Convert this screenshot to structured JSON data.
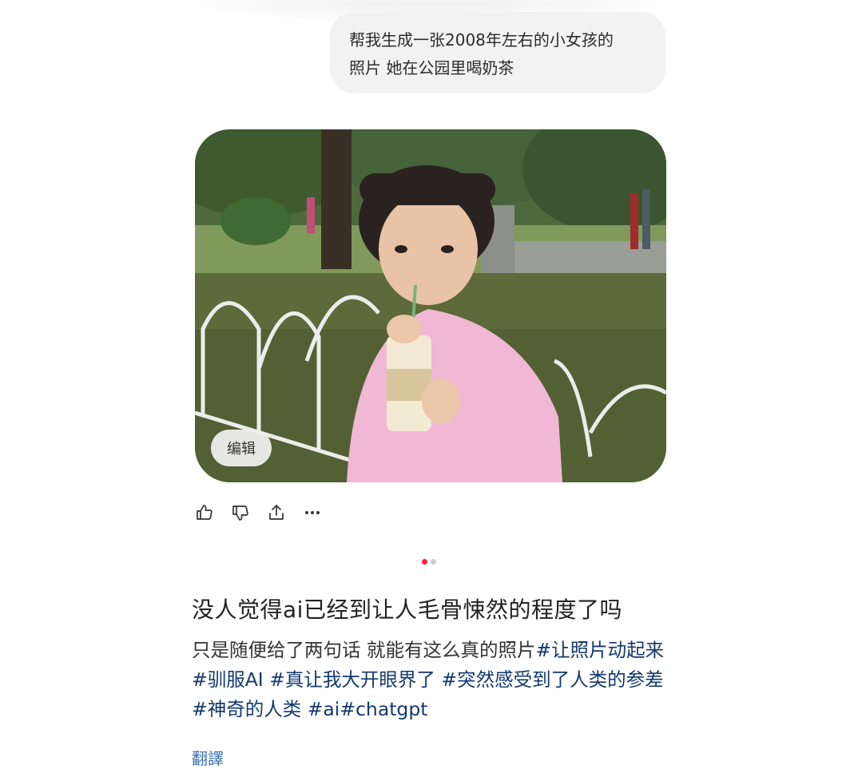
{
  "chat": {
    "user_message_line1": "帮我生成一张2008年左右的小女孩的",
    "user_message_line2": "照片 她在公园里喝奶茶"
  },
  "image_card": {
    "edit_label": "编辑"
  },
  "actions": {
    "icons": [
      "thumbs-up-icon",
      "thumbs-down-icon",
      "share-icon",
      "more-icon"
    ]
  },
  "pagination": {
    "total": 2,
    "active": 1
  },
  "post": {
    "title": "没人觉得ai已经到让人毛骨悚然的程度了吗",
    "body_text": "只是随便给了两句话 就能有这么真的照片",
    "tags": [
      "#让照片动起来",
      "#驯服AI",
      "#真让我大开眼界了",
      "#突然感受到了人类的参差",
      "#神奇的人类",
      "#ai",
      "#chatgpt"
    ],
    "translate_label": "翻譯"
  },
  "colors": {
    "accent": "#ff2442",
    "tag": "#13386c",
    "link": "#3b6fb0",
    "bubble": "#f2f2f2"
  }
}
